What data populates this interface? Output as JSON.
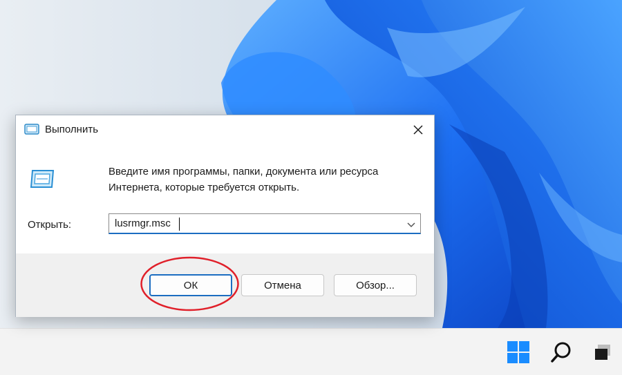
{
  "dialog": {
    "title": "Выполнить",
    "instructions_line1": "Введите имя программы, папки, документа или ресурса",
    "instructions_line2": "Интернета, которые требуется открыть.",
    "open_label": "Открыть:",
    "command_value": "lusrmgr.msc",
    "ok_label": "ОК",
    "cancel_label": "Отмена",
    "browse_label": "Обзор..."
  },
  "icons": {
    "title_icon": "run-icon",
    "big_icon": "run-icon",
    "close": "close-icon",
    "dropdown": "chevron-down-icon",
    "start": "windows-start-icon",
    "search": "search-icon",
    "task_view": "task-view-icon"
  },
  "colors": {
    "accent": "#1b6dc1",
    "highlight_ring": "#e0202a",
    "taskbar": "#f3f3f3",
    "button_bar": "#f0f0f0"
  }
}
